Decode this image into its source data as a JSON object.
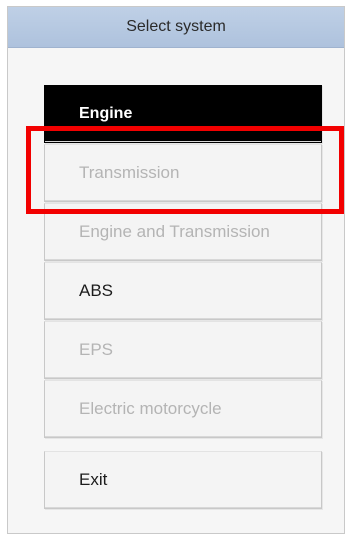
{
  "window": {
    "title": "Select system"
  },
  "systems": [
    {
      "label": "Engine",
      "state": "selected"
    },
    {
      "label": "Transmission",
      "state": "disabled"
    },
    {
      "label": "Engine and Transmission",
      "state": "disabled"
    },
    {
      "label": "ABS",
      "state": "enabled"
    },
    {
      "label": "EPS",
      "state": "disabled"
    },
    {
      "label": "Electric motorcycle",
      "state": "disabled"
    }
  ],
  "exit_label": "Exit",
  "colors": {
    "title_bar": "#aec2dd",
    "selected_bg": "#000000",
    "disabled_text": "#b4b4b4",
    "highlight": "#f20000"
  }
}
